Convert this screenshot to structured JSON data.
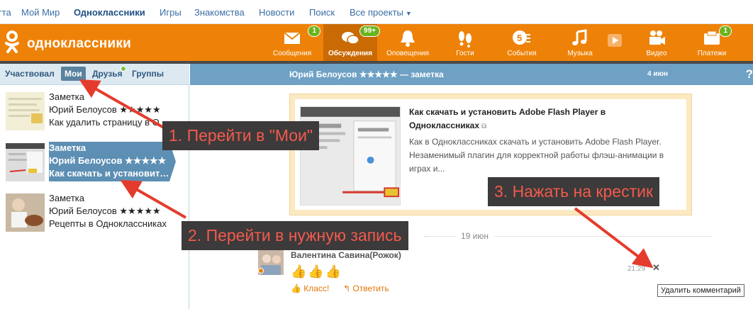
{
  "portal": {
    "items": [
      "гта",
      "Мой Мир",
      "Одноклассники",
      "Игры",
      "Знакомства",
      "Новости",
      "Поиск",
      "Все проекты"
    ]
  },
  "header": {
    "logo_text": "одноклассники",
    "nav": [
      {
        "label": "Сообщения",
        "icon": "envelope-icon",
        "badge": "1"
      },
      {
        "label": "Обсуждения",
        "icon": "chat-bubbles-icon",
        "badge": "99+"
      },
      {
        "label": "Оповещения",
        "icon": "bell-icon",
        "badge": ""
      },
      {
        "label": "Гости",
        "icon": "footprints-icon",
        "badge": ""
      },
      {
        "label": "События",
        "icon": "events-icon",
        "badge": "5"
      },
      {
        "label": "Музыка",
        "icon": "music-note-icon",
        "badge": ""
      },
      {
        "label": "",
        "icon": "play-icon",
        "badge": ""
      },
      {
        "label": "Видео",
        "icon": "video-camera-icon",
        "badge": ""
      },
      {
        "label": "Платежи",
        "icon": "payments-icon",
        "badge": "1"
      }
    ]
  },
  "left": {
    "tabs": [
      "Участвовал",
      "Мои",
      "Друзья",
      "Группы"
    ],
    "active_tab": "Мои",
    "conversations": [
      {
        "line1": "Заметка",
        "line2": "Юрий Белоусов ★★★★★",
        "line3": "Как удалить страницу в Одноклассниках"
      },
      {
        "line1": "Заметка",
        "line2": "Юрий Белоусов ★★★★★",
        "line3": "Как скачать и установить Adobe Flash Player"
      },
      {
        "line1": "Заметка",
        "line2": "Юрий Белоусов ★★★★★",
        "line3": "Рецепты в Одноклассниках"
      }
    ]
  },
  "right": {
    "title": "Юрий Белоусов ★★★★★ — заметка",
    "date": "4 июн",
    "help": "?",
    "card": {
      "title": "Как скачать и установить Adobe Flash Player в Одноклассниках",
      "description": "Как в Одноклассниках скачать и установить Adobe Flash Player. Незаменимый плагин для корректной работы флэш-анимации в играх и..."
    },
    "separator_date": "19 июн",
    "comment": {
      "author": "Валентина Савина(Рожок)",
      "time": "21:29",
      "like_label": "Класс!",
      "reply_label": "Ответить",
      "delete_tooltip": "Удалить комментарий"
    }
  },
  "annotations": {
    "step1": "1. Перейти в \"Мои\"",
    "step2": "2. Перейти в нужную запись",
    "step3": "3. Нажать на крестик"
  },
  "colors": {
    "header_orange": "#ee8208",
    "badge_green": "#6bb31c",
    "selected_blue": "#5d8fb4",
    "annotation_red": "#e53b2c"
  }
}
